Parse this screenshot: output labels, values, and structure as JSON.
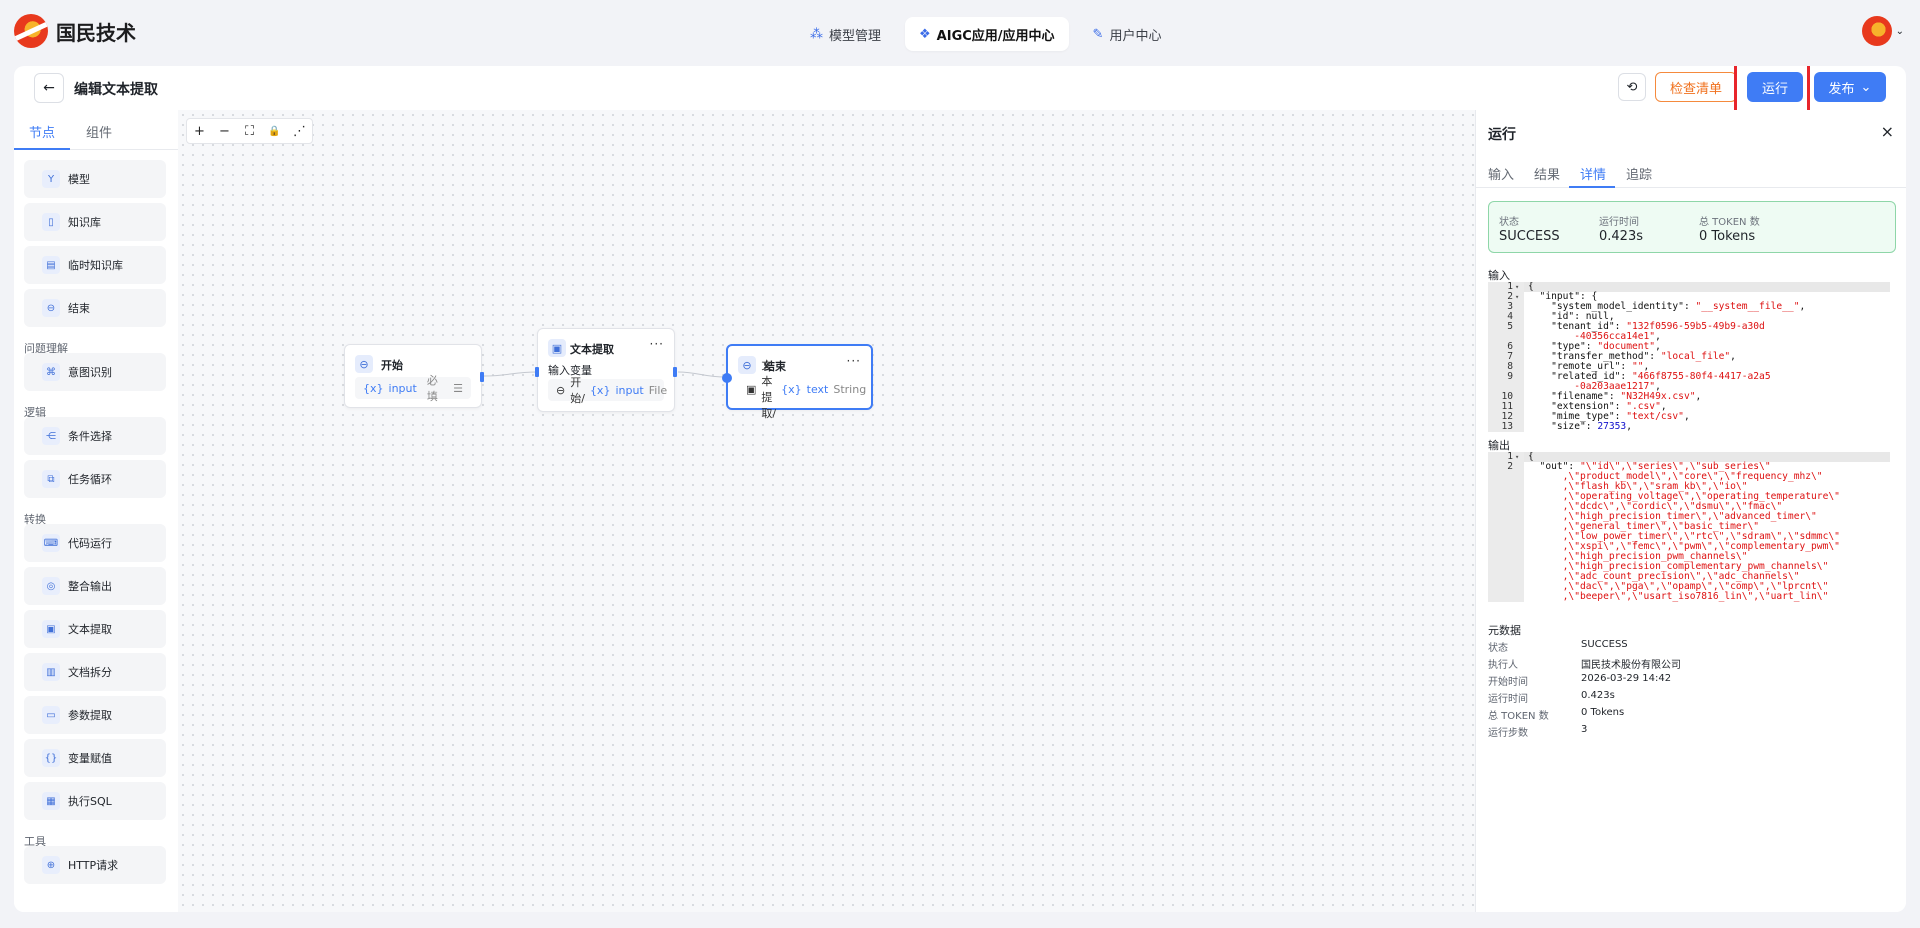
{
  "app": {
    "logo_text": "国民技术"
  },
  "nav": [
    {
      "label": "模型管理",
      "icon": "model-icon",
      "active": false
    },
    {
      "label": "AIGC应用/应用中心",
      "icon": "app-icon",
      "active": true
    },
    {
      "label": "用户中心",
      "icon": "user-center-icon",
      "active": false
    }
  ],
  "header": {
    "back": "←",
    "title": "编辑文本提取",
    "history_icon": "⟲",
    "check_label": "检查清单",
    "run_label": "运行",
    "publish_label": "发布",
    "publish_caret": "⌄"
  },
  "left_panel": {
    "tabs": [
      "节点",
      "组件"
    ],
    "categories": [
      "问题理解",
      "逻辑",
      "转换",
      "工具"
    ],
    "items": [
      "模型",
      "知识库",
      "临时知识库",
      "结束",
      "意图识别",
      "条件选择",
      "任务循环",
      "代码运行",
      "整合输出",
      "文本提取",
      "文档拆分",
      "参数提取",
      "变量赋值",
      "执行SQL",
      "HTTP请求"
    ]
  },
  "toolbar": {
    "zoom_in": "+",
    "zoom_out": "−",
    "fit": "⛶",
    "lock": "🔒",
    "share": "⋰"
  },
  "nodes": {
    "start": {
      "title": "开始",
      "var_prefix": "{x}",
      "var_name": "input",
      "required": "必填"
    },
    "extract": {
      "title": "文本提取",
      "more": "···",
      "label": "输入变量",
      "source": "开始/",
      "var_prefix": "{x}",
      "var_name": "input",
      "var_type": "File"
    },
    "end": {
      "title": "结束",
      "more": "···",
      "source": "文本提取/",
      "var_prefix": "{x}",
      "var_name": "text",
      "var_type": "String"
    }
  },
  "run_panel": {
    "title": "运行",
    "close": "×",
    "tabs": [
      "输入",
      "结果",
      "详情",
      "追踪"
    ],
    "active_tab": "详情",
    "status": {
      "status_label": "状态",
      "status_value": "SUCCESS",
      "time_label": "运行时间",
      "time_value": "0.423s",
      "token_label": "总 TOKEN 数",
      "token_value": "0 Tokens"
    },
    "input_label": "输入",
    "input_lines": [
      {
        "n": "1",
        "fold": true,
        "t": "{"
      },
      {
        "n": "2",
        "fold": true,
        "t": "  \"input\": {"
      },
      {
        "n": "3",
        "k": "    \"system_model_identity\": ",
        "s": "\"__system__file__\"",
        "e": ","
      },
      {
        "n": "4",
        "t": "    \"id\": null,"
      },
      {
        "n": "5",
        "k": "    \"tenant_id\": ",
        "s": "\"132f0596-59b5-49b9-a30d"
      },
      {
        "n": "",
        "s": "        -40356cca14e1\"",
        "e": ","
      },
      {
        "n": "6",
        "k": "    \"type\": ",
        "s": "\"document\"",
        "e": ","
      },
      {
        "n": "7",
        "k": "    \"transfer_method\": ",
        "s": "\"local_file\"",
        "e": ","
      },
      {
        "n": "8",
        "k": "    \"remote_url\": ",
        "s": "\"\"",
        "e": ","
      },
      {
        "n": "9",
        "k": "    \"related_id\": ",
        "s": "\"466f8755-80f4-4417-a2a5"
      },
      {
        "n": "",
        "s": "        -0a203aae1217\"",
        "e": ","
      },
      {
        "n": "10",
        "k": "    \"filename\": ",
        "s": "\"N32H49x.csv\"",
        "e": ","
      },
      {
        "n": "11",
        "k": "    \"extension\": ",
        "s": "\".csv\"",
        "e": ","
      },
      {
        "n": "12",
        "k": "    \"mime_type\": ",
        "s": "\"text/csv\"",
        "e": ","
      },
      {
        "n": "13",
        "k": "    \"size\": ",
        "num": "27353",
        "e": ","
      }
    ],
    "output_label": "输出",
    "output_lines": [
      {
        "n": "1",
        "fold": true,
        "t": "{"
      },
      {
        "n": "2",
        "k": "  \"out\": ",
        "s": "\"\\\"id\\\",\\\"series\\\",\\\"sub_series\\\""
      },
      {
        "s": "      ,\\\"product_model\\\",\\\"core\\\",\\\"frequency_mhz\\\""
      },
      {
        "s": "      ,\\\"flash_kb\\\",\\\"sram_kb\\\",\\\"io\\\""
      },
      {
        "s": "      ,\\\"operating_voltage\\\",\\\"operating_temperature\\\""
      },
      {
        "s": "      ,\\\"dcdc\\\",\\\"cordic\\\",\\\"dsmu\\\",\\\"fmac\\\""
      },
      {
        "s": "      ,\\\"high_precision_timer\\\",\\\"advanced_timer\\\""
      },
      {
        "s": "      ,\\\"general_timer\\\",\\\"basic_timer\\\""
      },
      {
        "s": "      ,\\\"low_power_timer\\\",\\\"rtc\\\",\\\"sdram\\\",\\\"sdmmc\\\""
      },
      {
        "s": "      ,\\\"xspi\\\",\\\"femc\\\",\\\"pwm\\\",\\\"complementary_pwm\\\""
      },
      {
        "s": "      ,\\\"high_precision_pwm_channels\\\""
      },
      {
        "s": "      ,\\\"high_precision_complementary_pwm_channels\\\""
      },
      {
        "s": "      ,\\\"adc_count_precision\\\",\\\"adc_channels\\\""
      },
      {
        "s": "      ,\\\"dac\\\",\\\"pga\\\",\\\"opamp\\\",\\\"comp\\\",\\\"lprcnt\\\""
      },
      {
        "s": "      ,\\\"beeper\\\",\\\"usart_iso7816_lin\\\",\\\"uart_lin\\\""
      }
    ],
    "meta_label": "元数据",
    "meta": [
      {
        "k": "状态",
        "v": "SUCCESS"
      },
      {
        "k": "执行人",
        "v": "国民技术股份有限公司"
      },
      {
        "k": "开始时间",
        "v": "2026-03-29 14:42"
      },
      {
        "k": "运行时间",
        "v": "0.423s"
      },
      {
        "k": "总 TOKEN 数",
        "v": "0 Tokens"
      },
      {
        "k": "运行步数",
        "v": "3"
      }
    ]
  },
  "colors": {
    "primary": "#3f7cf5",
    "warning": "#f0711e",
    "success_bg": "#eefbf3",
    "highlight": "#e8252b"
  }
}
